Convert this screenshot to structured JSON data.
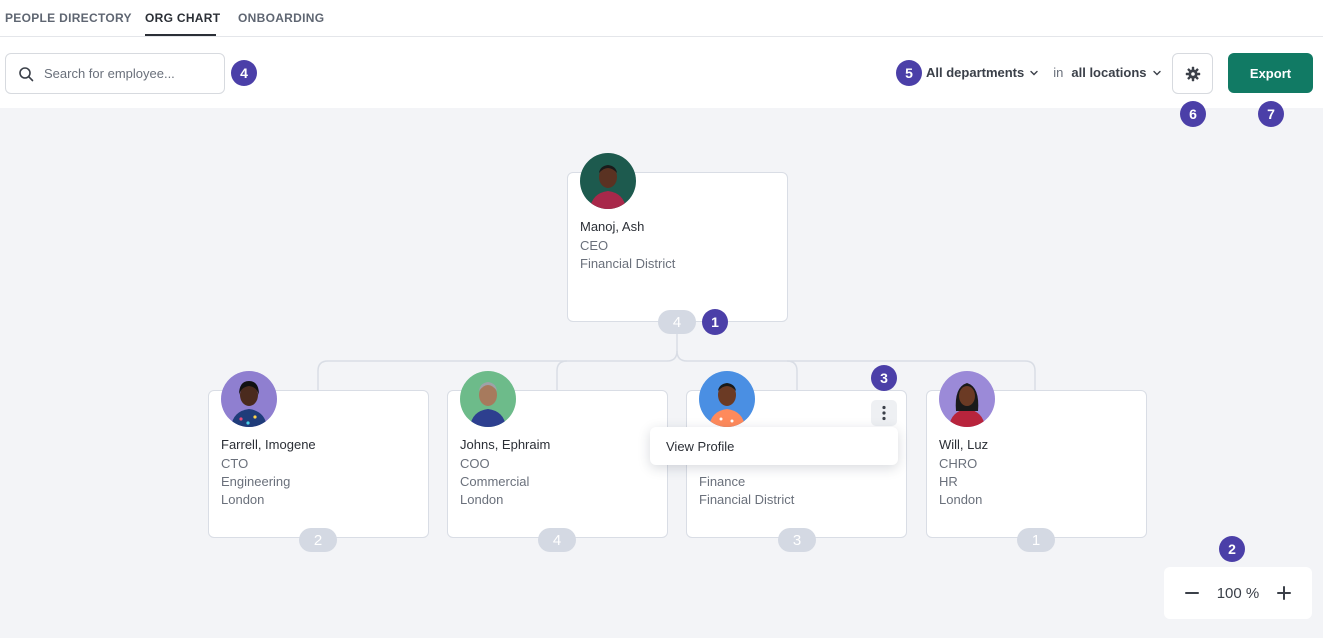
{
  "tabs": [
    {
      "label": "PEOPLE DIRECTORY",
      "active": false
    },
    {
      "label": "ORG CHART",
      "active": true
    },
    {
      "label": "ONBOARDING",
      "active": false
    }
  ],
  "search": {
    "placeholder": "Search for employee..."
  },
  "filters": {
    "department": "All departments",
    "joiner": "in",
    "location": "all locations"
  },
  "toolbar": {
    "export_label": "Export"
  },
  "annotations": [
    "1",
    "2",
    "3",
    "4",
    "5",
    "6",
    "7"
  ],
  "colors": {
    "accent": "#117a64",
    "badge": "#4b3fa8",
    "canvas": "#f3f4f7",
    "count_pill": "#d4d9e3"
  },
  "org": {
    "root": {
      "name": "Manoj, Ash",
      "title": "CEO",
      "location": "Financial District",
      "reports": "4",
      "avatar_bg": "#1d5a4e"
    },
    "children": [
      {
        "name": "Farrell, Imogene",
        "title": "CTO",
        "department": "Engineering",
        "location": "London",
        "reports": "2",
        "avatar_bg": "#8f7fd0"
      },
      {
        "name": "Johns, Ephraim",
        "title": "COO",
        "department": "Commercial",
        "location": "London",
        "reports": "4",
        "avatar_bg": "#6dbb8a"
      },
      {
        "name": "",
        "title": "",
        "department": "Finance",
        "location": "Financial District",
        "reports": "3",
        "avatar_bg": "#4a8fe3"
      },
      {
        "name": "Will, Luz",
        "title": "CHRO",
        "department": "HR",
        "location": "London",
        "reports": "1",
        "avatar_bg": "#9b8ad8"
      }
    ]
  },
  "context_menu": {
    "items": [
      "View Profile"
    ]
  },
  "zoom": {
    "value": "100 %"
  }
}
